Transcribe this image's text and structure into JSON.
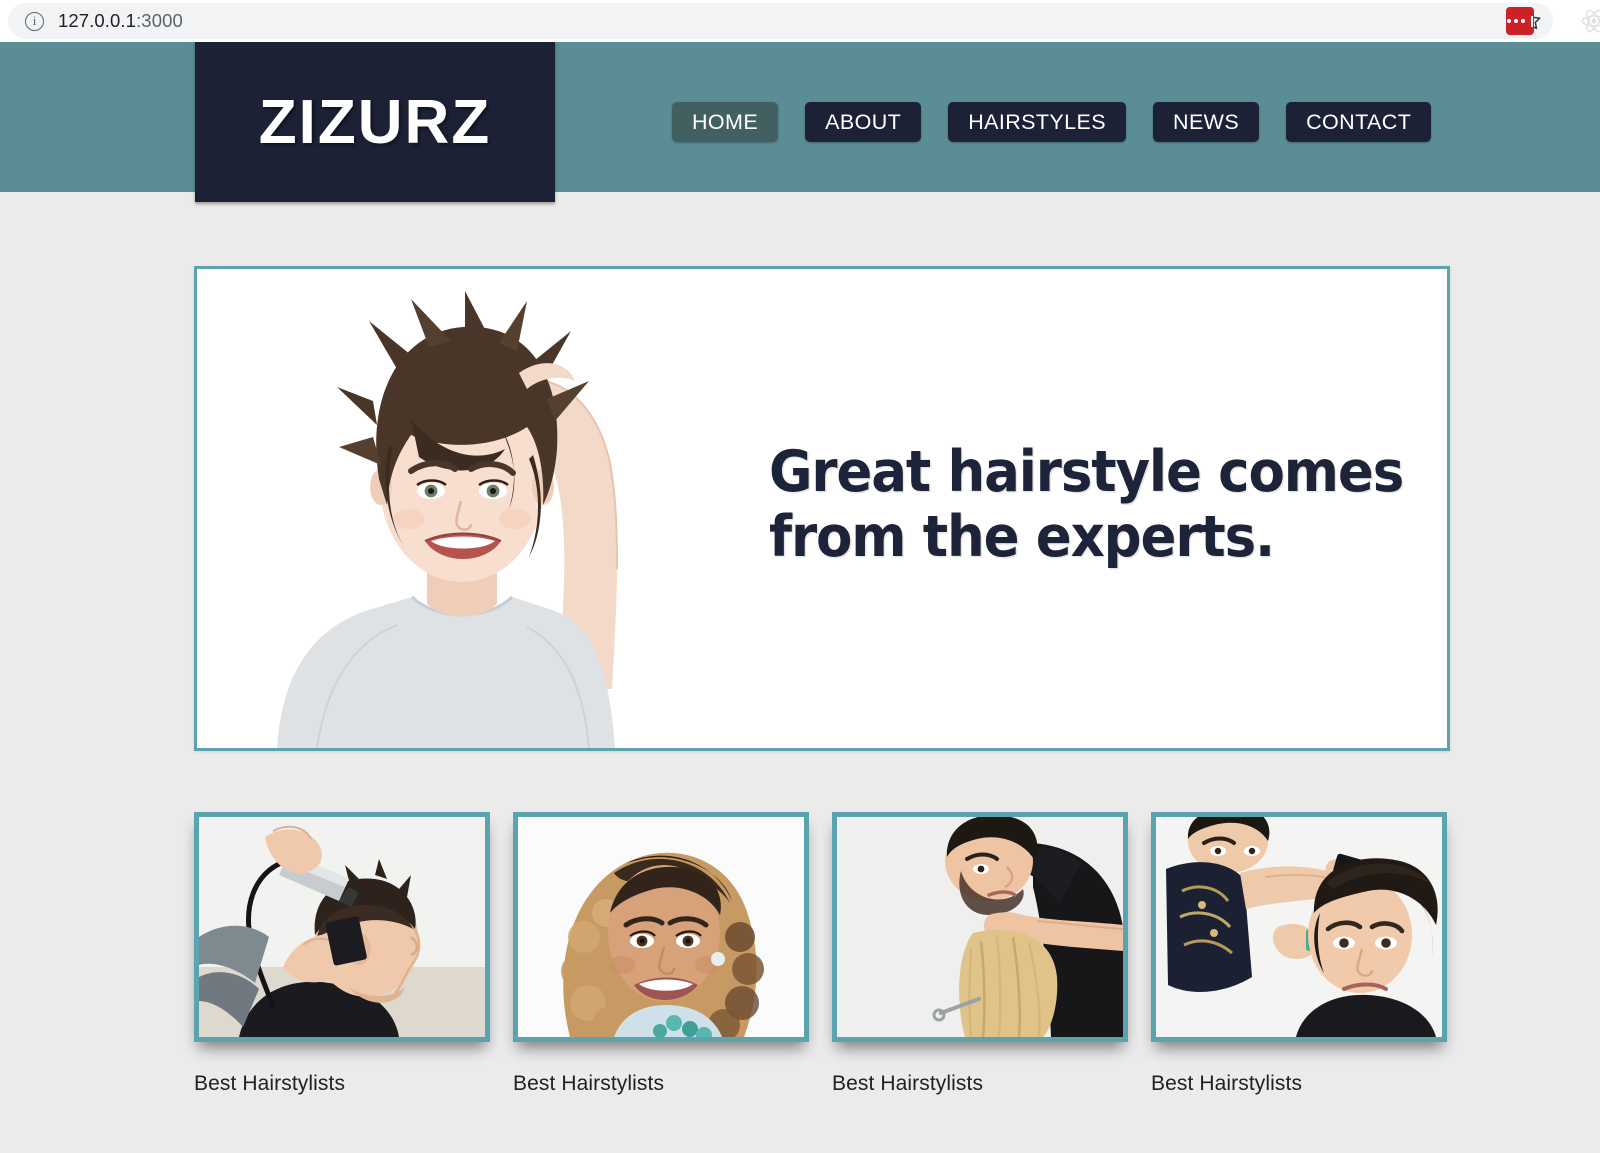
{
  "browser": {
    "url_host": "127.0.0.1",
    "url_port": ":3000",
    "info_icon": "info-icon",
    "star_icon": "bookmark-star-icon",
    "extension_red_icon": "extension-red-dots-icon",
    "extension_react_icon": "react-devtools-icon"
  },
  "site": {
    "logo": "ZIZURZ",
    "colors": {
      "header_teal": "#5a8d95",
      "logo_navy": "#1d2135",
      "nav_active": "#41605f",
      "border_teal": "#5ba3ae",
      "page_background": "#ebebeb",
      "heading_navy": "#1d2338"
    },
    "nav": [
      {
        "label": "HOME",
        "active": true
      },
      {
        "label": "ABOUT",
        "active": false
      },
      {
        "label": "HAIRSTYLES",
        "active": false
      },
      {
        "label": "NEWS",
        "active": false
      },
      {
        "label": "CONTACT",
        "active": false
      }
    ],
    "hero": {
      "heading_line1": "Great hairstyle comes",
      "heading_line2": "from the experts.",
      "image_alt": "smiling-woman-short-pixie-hairstyle"
    },
    "cards": [
      {
        "label": "Best Hairstylists",
        "image_alt": "barber-clipper-mens-haircut"
      },
      {
        "label": "Best Hairstylists",
        "image_alt": "woman-curly-ombre-hair-portrait"
      },
      {
        "label": "Best Hairstylists",
        "image_alt": "stylist-cutting-blonde-hair"
      },
      {
        "label": "Best Hairstylists",
        "image_alt": "stylist-combing-mens-pompadour"
      }
    ]
  }
}
